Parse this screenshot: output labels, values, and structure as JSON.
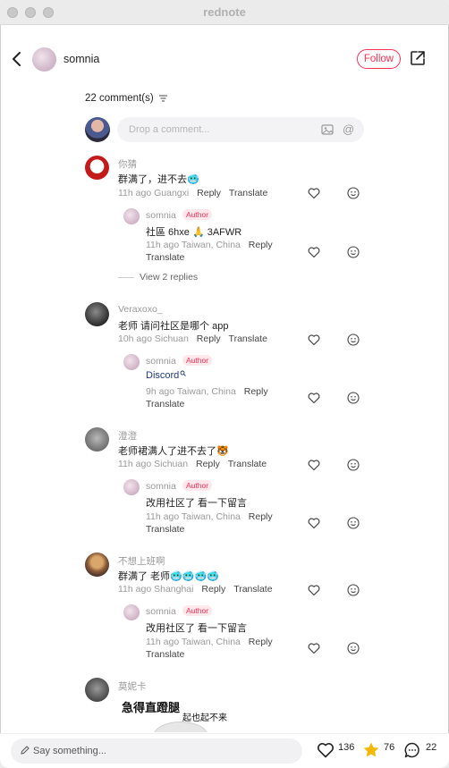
{
  "window": {
    "title": "rednote"
  },
  "header": {
    "author_name": "somnia",
    "follow_label": "Follow"
  },
  "comments_count_label": "22 comment(s)",
  "composer": {
    "placeholder": "Drop a comment..."
  },
  "comments": [
    {
      "name": "你猜",
      "text": "群满了，进不去🥶",
      "time": "11h ago",
      "location": "Guangxi",
      "reply_label": "Reply",
      "translate_label": "Translate",
      "author_reply": {
        "name": "somnia",
        "badge": "Author",
        "text": "社區 6hxe 🙏 3AFWR",
        "time": "11h ago",
        "location": "Taiwan, China",
        "reply_label": "Reply",
        "translate_label": "Translate"
      },
      "view_replies": "View 2 replies"
    },
    {
      "name": "Veraxoxo_",
      "text": "老师 请问社区是哪个 app",
      "time": "10h ago",
      "location": "Sichuan",
      "reply_label": "Reply",
      "translate_label": "Translate",
      "author_reply": {
        "name": "somnia",
        "badge": "Author",
        "text": "Discord",
        "time": "9h ago",
        "location": "Taiwan, China",
        "reply_label": "Reply",
        "translate_label": "Translate"
      }
    },
    {
      "name": "澄澄",
      "text": "老师裙满人了进不去了🐯",
      "time": "11h ago",
      "location": "Sichuan",
      "reply_label": "Reply",
      "translate_label": "Translate",
      "author_reply": {
        "name": "somnia",
        "badge": "Author",
        "text": "改用社区了 看一下留言",
        "time": "11h ago",
        "location": "Taiwan, China",
        "reply_label": "Reply",
        "translate_label": "Translate"
      }
    },
    {
      "name": "不想上班啊",
      "text": "群满了 老师🥶🥶🥶🥶",
      "time": "11h ago",
      "location": "Shanghai",
      "reply_label": "Reply",
      "translate_label": "Translate",
      "author_reply": {
        "name": "somnia",
        "badge": "Author",
        "text": "改用社区了 看一下留言",
        "time": "11h ago",
        "location": "Taiwan, China",
        "reply_label": "Reply",
        "translate_label": "Translate"
      }
    },
    {
      "name": "莫妮卡",
      "meme_text_big": "急得直蹬腿",
      "meme_text_small": "起也起不来"
    }
  ],
  "bottom": {
    "placeholder": "Say something...",
    "likes": "136",
    "stars": "76",
    "comments": "22"
  },
  "colors": {
    "accent": "#ff2f52",
    "star": "#f5b800"
  },
  "icons": [
    "back-icon",
    "share-icon",
    "image-icon",
    "at-icon",
    "heart-icon",
    "smile-icon",
    "pen-icon",
    "star-icon",
    "comment-icon",
    "sort-icon"
  ]
}
